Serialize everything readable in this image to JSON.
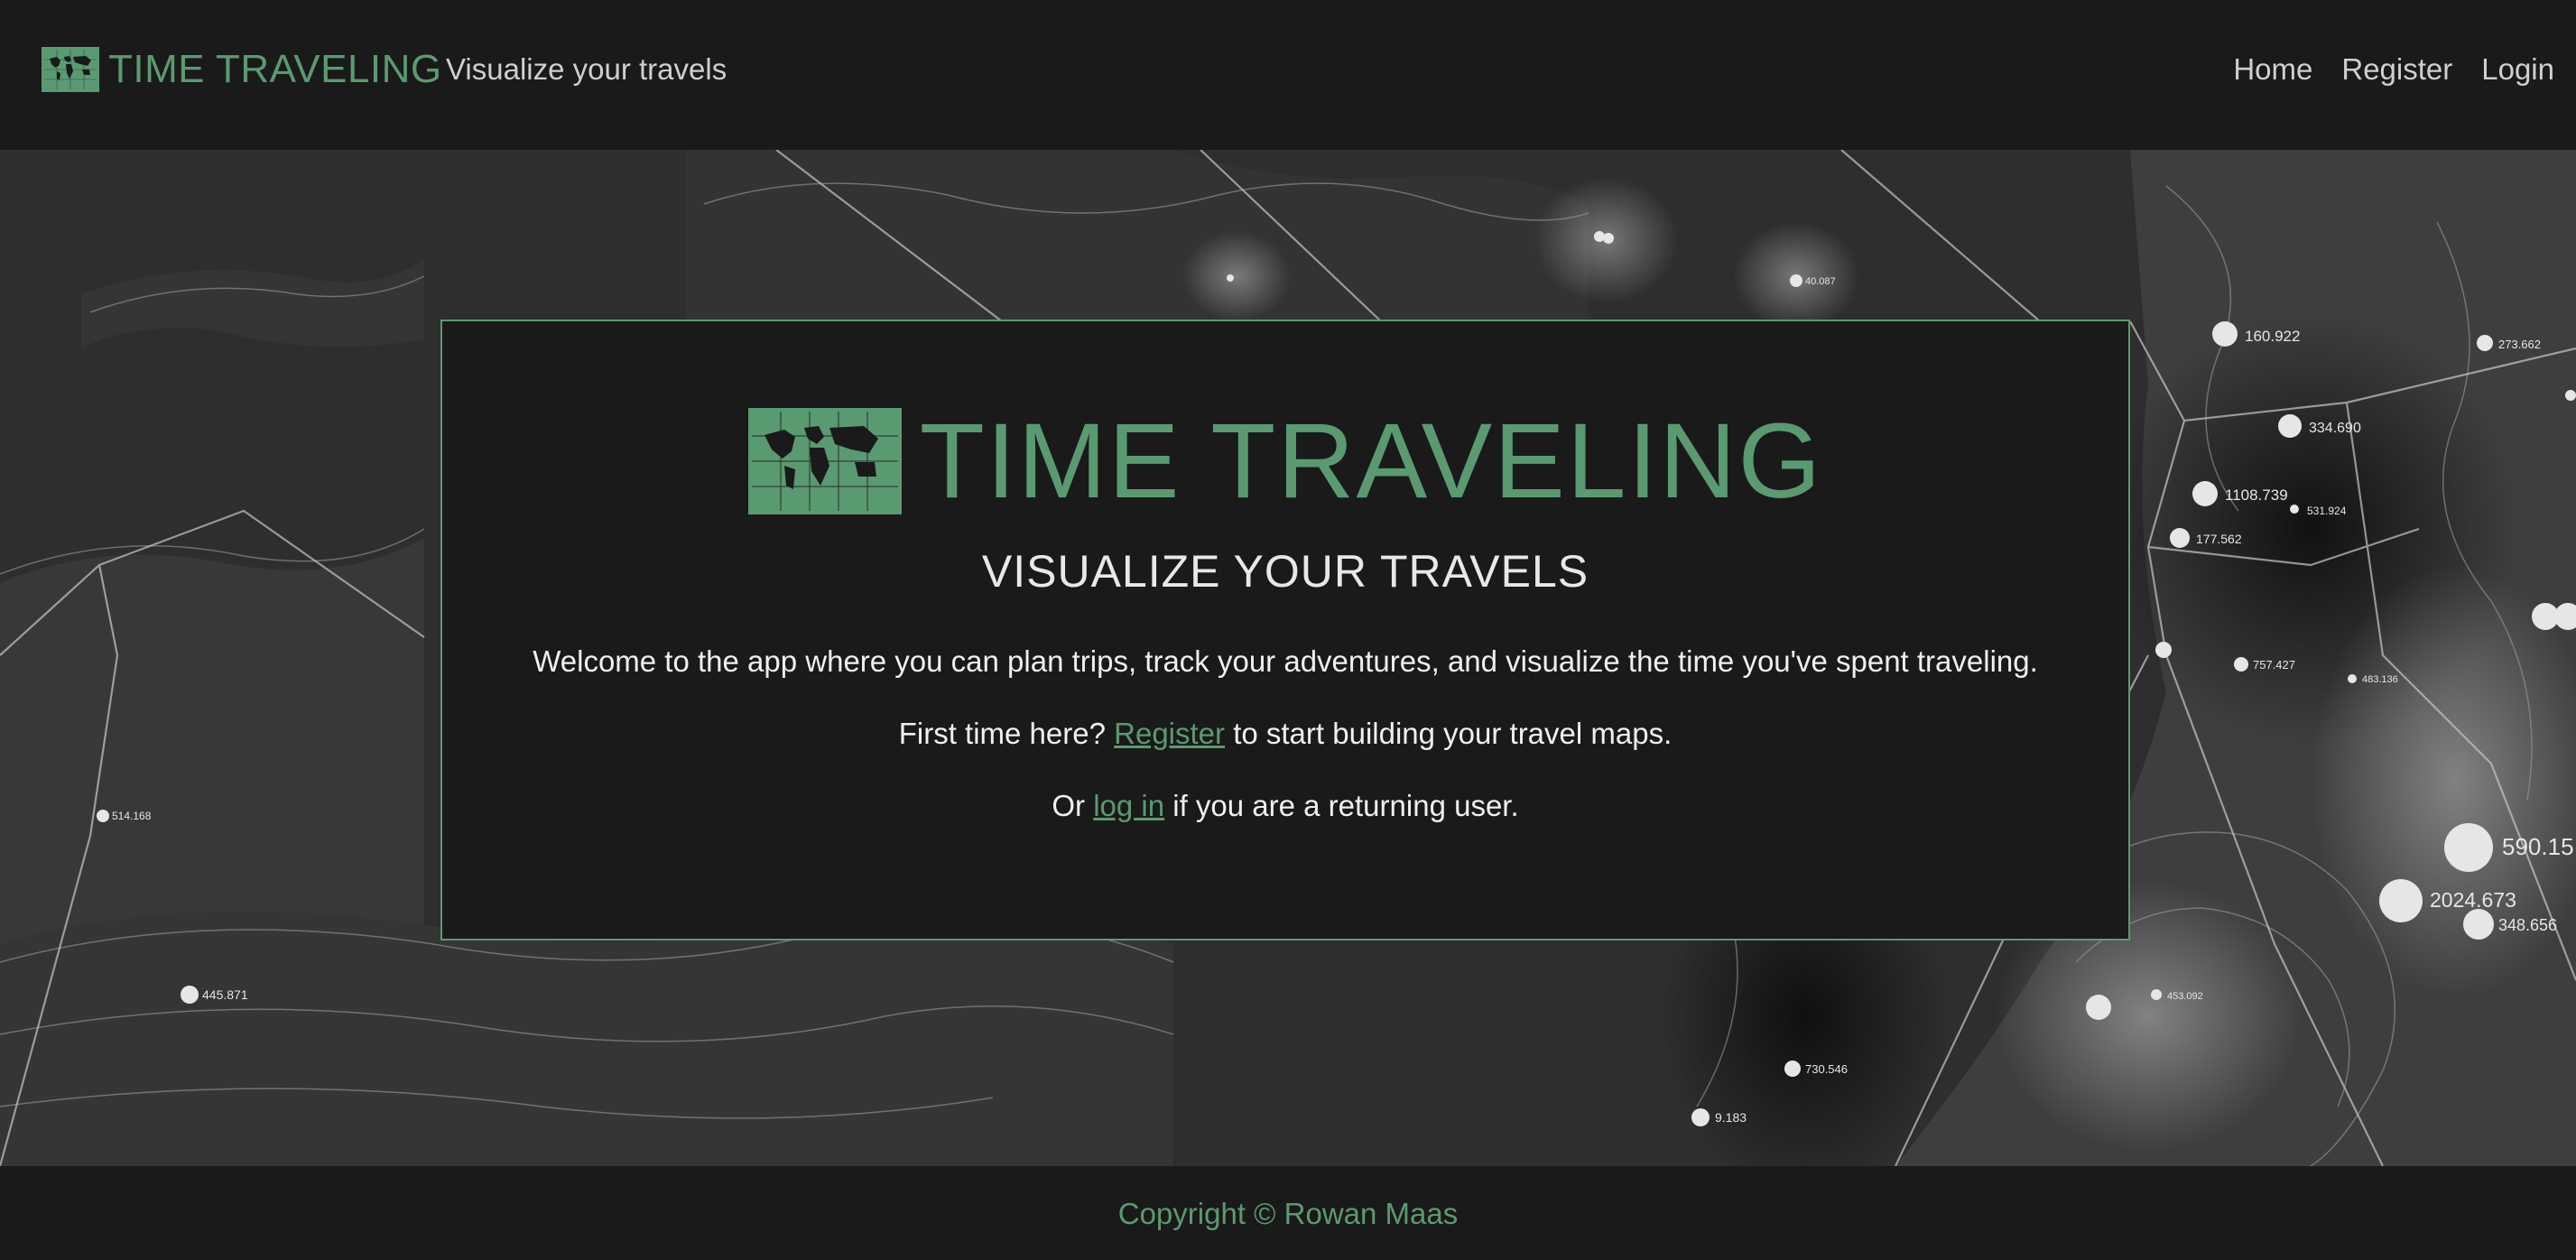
{
  "nav": {
    "brand": "TIME TRAVELING",
    "tagline": "Visualize your travels",
    "links": [
      "Home",
      "Register",
      "Login"
    ]
  },
  "hero": {
    "title": "TIME TRAVELING",
    "subtitle": "VISUALIZE YOUR TRAVELS",
    "welcome": "Welcome to the app where you can plan trips, track your adventures, and visualize the time you've spent traveling.",
    "first_prefix": "First time here? ",
    "first_link": "Register",
    "first_suffix": " to start building your travel maps.",
    "returning_prefix": "Or ",
    "returning_link": "log in",
    "returning_suffix": " if you are a returning user."
  },
  "map_labels": [
    "160.922",
    "273.662",
    "334.690",
    "1108.739",
    "531.924",
    "177.562",
    "757.427",
    "483.136",
    "590.15",
    "2024.673",
    "348.656",
    "453.092",
    "730.546",
    "9.183",
    "514.168",
    "445.871",
    "40.087"
  ],
  "footer": {
    "copyright": "Copyright © Rowan Maas"
  },
  "colors": {
    "accent": "#5a9a70",
    "background": "#1a1a1a",
    "map": "#2e2e2e"
  },
  "icons": {
    "logo": "world-map-icon"
  }
}
